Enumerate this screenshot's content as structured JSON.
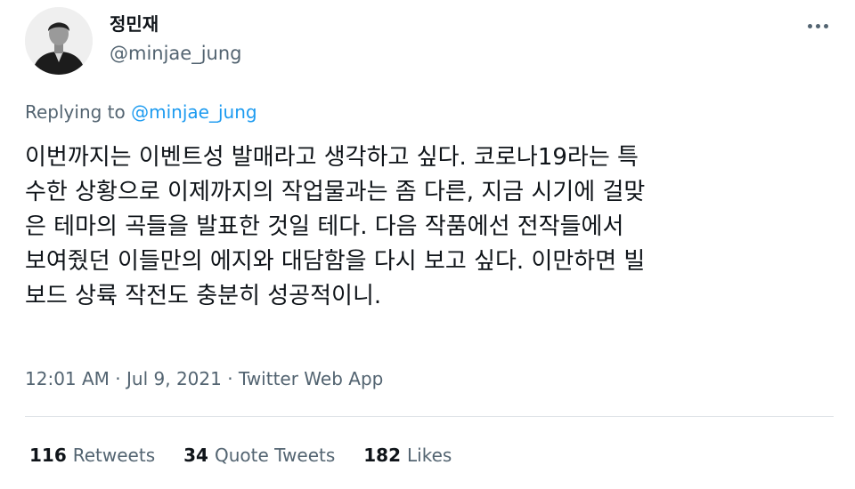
{
  "author": {
    "display_name": "정민재",
    "handle": "@minjae_jung"
  },
  "reply": {
    "prefix": "Replying to",
    "mention": "@minjae_jung"
  },
  "tweet": {
    "text": "이번까지는 이벤트성 발매라고 생각하고 싶다. 코로나19라는 특\n수한 상황으로 이제까지의 작업물과는 좀 다른, 지금 시기에 걸맞\n은 테마의 곡들을 발표한 것일 테다. 다음 작품에선 전작들에서\n보여줬던 이들만의 에지와 대담함을 다시 보고 싶다. 이만하면 빌\n보드 상륙 작전도 충분히 성공적이니."
  },
  "meta": {
    "time": "12:01 AM",
    "sep1": " · ",
    "date": "Jul 9, 2021",
    "sep2": " · ",
    "source": "Twitter Web App"
  },
  "stats": {
    "retweets": {
      "count": "116",
      "label": "Retweets"
    },
    "quotes": {
      "count": "34",
      "label": "Quote Tweets"
    },
    "likes": {
      "count": "182",
      "label": "Likes"
    }
  },
  "icons": {
    "more": "more-horizontal-icon"
  },
  "colors": {
    "text": "#0f1419",
    "secondary": "#536471",
    "link": "#1d9bf0",
    "divider": "#dfe3e7"
  }
}
